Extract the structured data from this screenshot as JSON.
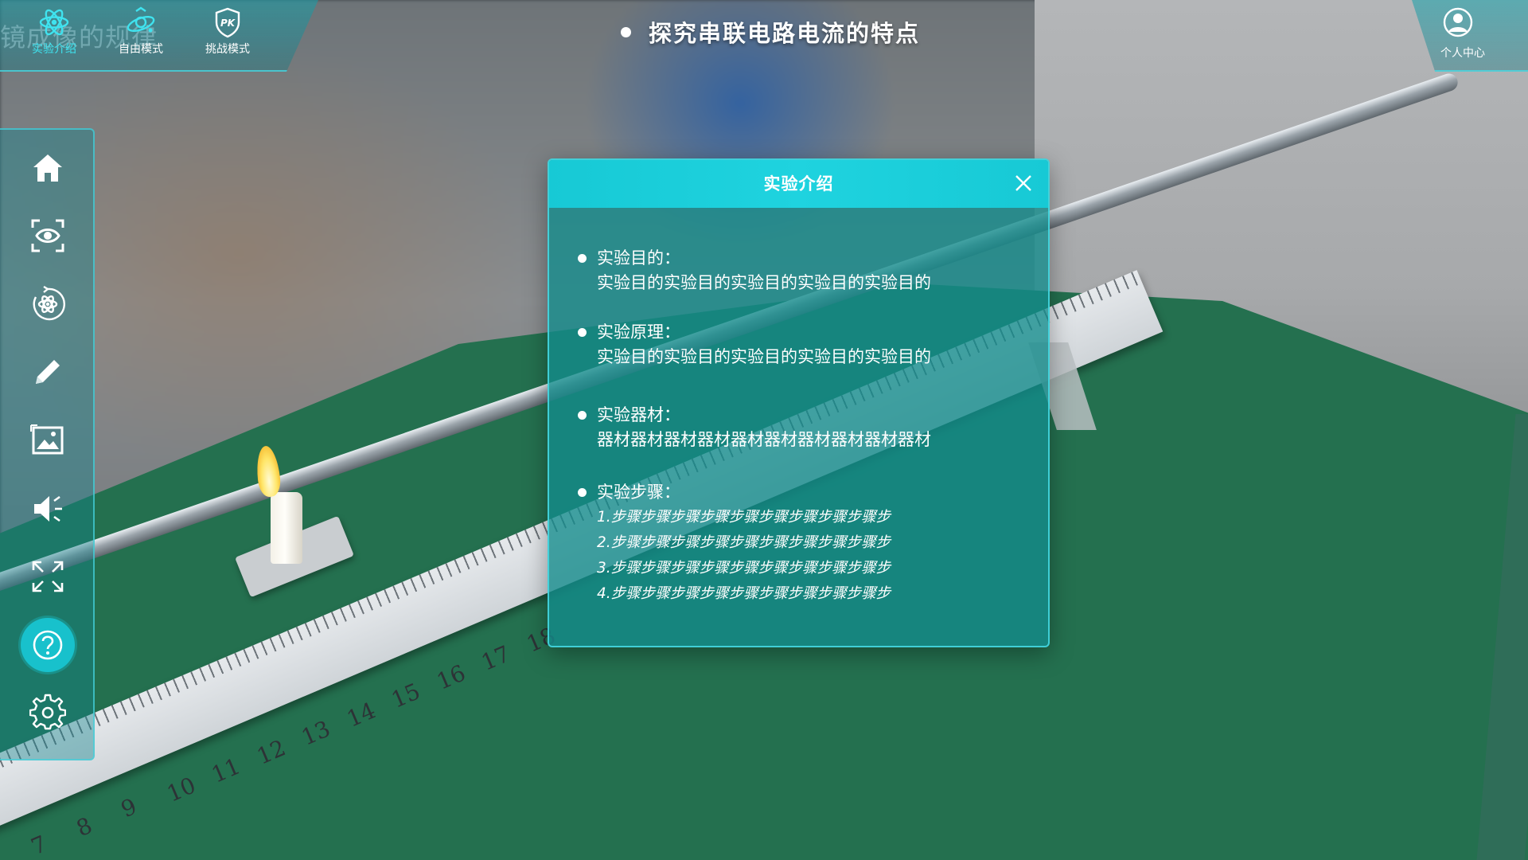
{
  "header": {
    "ghost_title": "镜成像的规律",
    "page_title": "探究串联电路电流的特点",
    "tabs": [
      {
        "label": "实验介绍",
        "icon": "atom-icon",
        "active": true
      },
      {
        "label": "自由模式",
        "icon": "orbit-icon",
        "active": false
      },
      {
        "label": "挑战模式",
        "icon": "pk-shield-icon",
        "active": false
      }
    ],
    "profile_label": "个人中心"
  },
  "sidebar": {
    "items": [
      {
        "name": "home",
        "icon": "home-icon"
      },
      {
        "name": "view",
        "icon": "eye-focus-icon"
      },
      {
        "name": "reset",
        "icon": "atom-rotate-icon"
      },
      {
        "name": "draw",
        "icon": "pencil-icon"
      },
      {
        "name": "image",
        "icon": "image-icon"
      },
      {
        "name": "sound",
        "icon": "speaker-icon"
      },
      {
        "name": "fullscreen",
        "icon": "fullscreen-icon"
      },
      {
        "name": "help",
        "icon": "help-icon",
        "active": true
      },
      {
        "name": "settings",
        "icon": "gear-icon"
      }
    ]
  },
  "dialog": {
    "title": "实验介绍",
    "sections": [
      {
        "heading": "实验目的：",
        "text": "实验目的实验目的实验目的实验目的实验目的"
      },
      {
        "heading": "实验原理：",
        "text": "实验目的实验目的实验目的实验目的实验目的"
      },
      {
        "heading": "实验器材：",
        "text": "器材器材器材器材器材器材器材器材器材器材"
      },
      {
        "heading": "实验步骤：",
        "steps": [
          "1.步骤步骤步骤步骤步骤步骤步骤步骤步骤步",
          "2.步骤步骤步骤步骤步骤步骤步骤步骤步骤步",
          "3.步骤步骤步骤步骤步骤步骤步骤步骤步骤步",
          "4.步骤步骤步骤步骤步骤步骤步骤步骤步骤步"
        ]
      }
    ]
  },
  "scene": {
    "ruler_numbers": [
      "7",
      "8",
      "9",
      "10",
      "11",
      "12",
      "13",
      "14",
      "15",
      "16",
      "17",
      "18"
    ],
    "colors": {
      "accent": "#18c1cc",
      "table": "#24704f",
      "dialog": "#128c8c"
    }
  }
}
